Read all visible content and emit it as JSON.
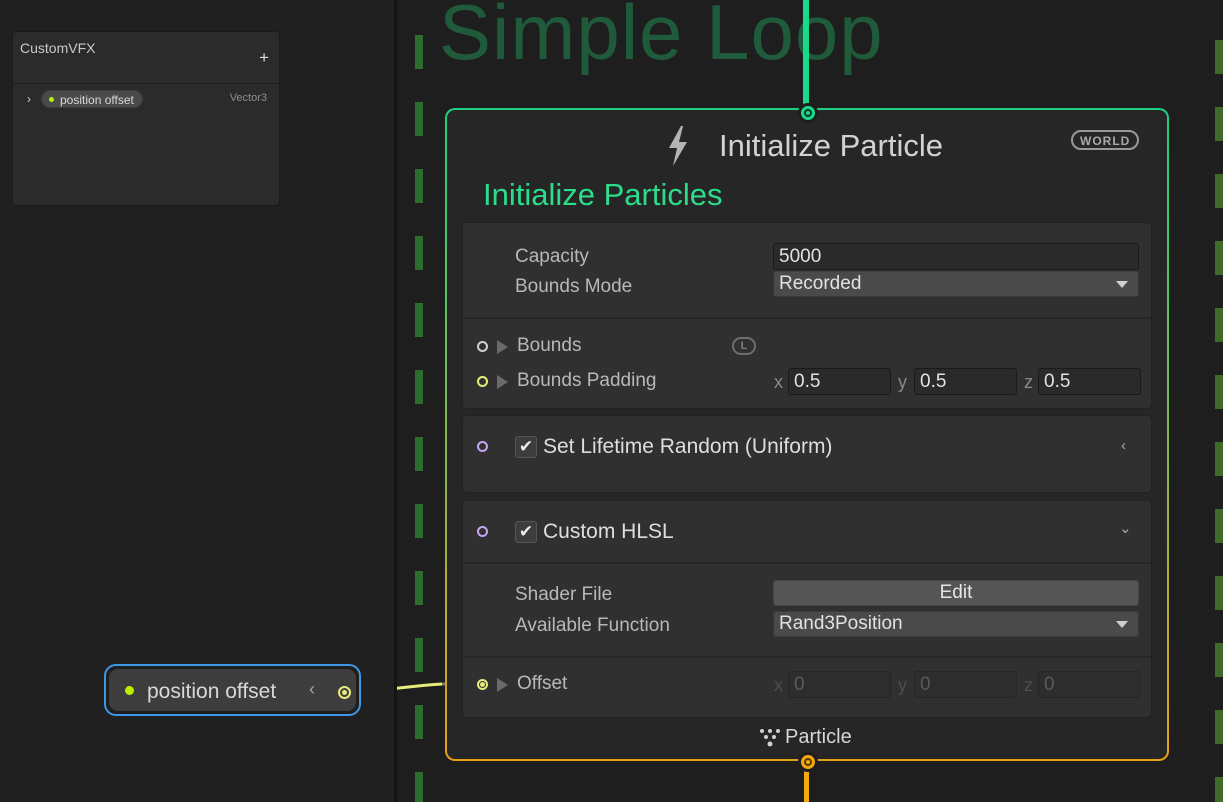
{
  "blackboard": {
    "title": "CustomVFX",
    "add_label": "+",
    "property": {
      "name": "position offset",
      "type": "Vector3",
      "expand_icon": "chevron-right-icon"
    }
  },
  "graph": {
    "system_title": "Simple Loop",
    "context": {
      "title": "Initialize Particle",
      "space_badge": "WORLD",
      "label": "Initialize Particles",
      "capacity": {
        "label": "Capacity",
        "value": "5000"
      },
      "bounds_mode": {
        "label": "Bounds Mode",
        "value": "Recorded"
      },
      "bounds": {
        "label": "Bounds",
        "space": "L"
      },
      "bounds_padding": {
        "label": "Bounds Padding",
        "x_label": "x",
        "x": "0.5",
        "y_label": "y",
        "y": "0.5",
        "z_label": "z",
        "z": "0.5"
      },
      "footer": "Particle"
    },
    "blocks": [
      {
        "title": "Set Lifetime Random (Uniform)",
        "enabled": true,
        "control_icon": "collapse-icon",
        "control_glyph": "‹"
      },
      {
        "title": "Custom HLSL",
        "enabled": true,
        "control_icon": "chevron-down-icon",
        "control_glyph": "⌄",
        "shader_file": {
          "label": "Shader File",
          "button": "Edit"
        },
        "available_function": {
          "label": "Available Function",
          "value": "Rand3Position"
        },
        "offset": {
          "label": "Offset",
          "x_label": "x",
          "x": "0",
          "y_label": "y",
          "y": "0",
          "z_label": "z",
          "z": "0"
        }
      }
    ],
    "property_node": {
      "label": "position offset",
      "chevron": "‹"
    }
  },
  "colors": {
    "flow_in": "#1ad98a",
    "flow_out": "#f2a70f",
    "vector3_slot": "#e8ec7a",
    "property_dot": "#b7f000",
    "selection_outline": "#3c98e6",
    "system_title": "#1f5a3a"
  }
}
